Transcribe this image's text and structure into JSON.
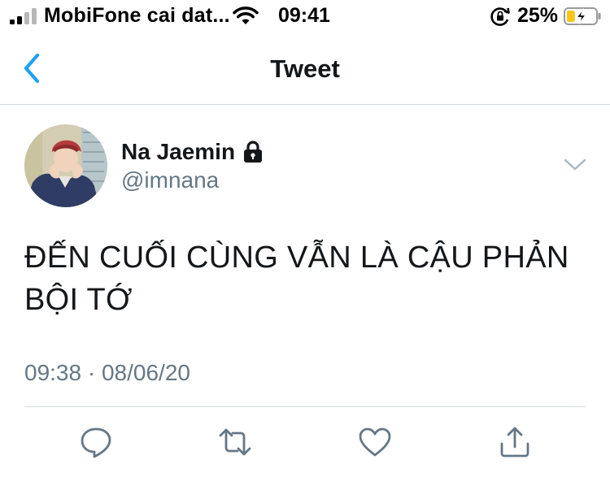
{
  "status_bar": {
    "carrier": "MobiFone cai dat...",
    "time": "09:41",
    "battery_percent": "25%",
    "battery_level": 0.25,
    "icons": [
      "signal-icon",
      "wifi-icon",
      "rotation-lock-icon",
      "battery-charging-icon"
    ]
  },
  "nav": {
    "back_icon": "chevron-left-icon",
    "title": "Tweet"
  },
  "tweet": {
    "author": {
      "display_name": "Na Jaemin",
      "handle": "@imnana",
      "protected_icon": "lock-icon"
    },
    "text_line1": "ĐẾN CUỐI CÙNG VẪN LÀ CẬU PHẢN",
    "text_line2": "BỘI TỚ",
    "time": "09:38",
    "separator": "·",
    "date": "08/06/20"
  },
  "actions": [
    {
      "name": "reply",
      "icon": "reply-icon"
    },
    {
      "name": "retweet",
      "icon": "retweet-icon"
    },
    {
      "name": "like",
      "icon": "heart-icon"
    },
    {
      "name": "share",
      "icon": "share-icon"
    }
  ],
  "colors": {
    "accent": "#1da1f2",
    "icon_gray": "#657786",
    "text": "#14171a",
    "battery": "#f5c518"
  }
}
